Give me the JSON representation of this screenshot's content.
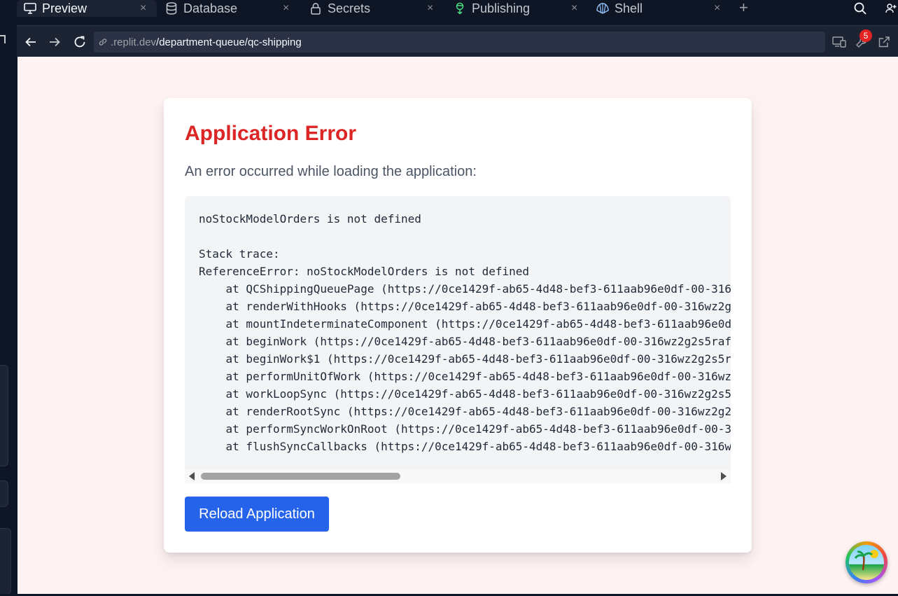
{
  "tabs": [
    {
      "label": "Preview",
      "icon": "monitor-icon",
      "active": true
    },
    {
      "label": "Database",
      "icon": "database-icon",
      "active": false
    },
    {
      "label": "Secrets",
      "icon": "lock-icon",
      "active": false
    },
    {
      "label": "Publishing",
      "icon": "publish-icon",
      "active": false
    },
    {
      "label": "Shell",
      "icon": "shell-icon",
      "active": false
    }
  ],
  "close_glyph": "×",
  "add_glyph": "+",
  "url": {
    "host": ".replit.dev",
    "path": "/department-queue/qc-shipping"
  },
  "devtools_badge": "5",
  "error": {
    "title": "Application Error",
    "subtitle": "An error occurred while loading the application:",
    "message": "noStockModelOrders is not defined",
    "stack_label": "Stack trace:",
    "exception": "ReferenceError: noStockModelOrders is not defined",
    "frames": [
      "    at QCShippingQueuePage (https://0ce1429f-ab65-4d48-bef3-611aab96e0df-00-316",
      "    at renderWithHooks (https://0ce1429f-ab65-4d48-bef3-611aab96e0df-00-316wz2g",
      "    at mountIndeterminateComponent (https://0ce1429f-ab65-4d48-bef3-611aab96e0d",
      "    at beginWork (https://0ce1429f-ab65-4d48-bef3-611aab96e0df-00-316wz2g2s5raf",
      "    at beginWork$1 (https://0ce1429f-ab65-4d48-bef3-611aab96e0df-00-316wz2g2s5r",
      "    at performUnitOfWork (https://0ce1429f-ab65-4d48-bef3-611aab96e0df-00-316wz",
      "    at workLoopSync (https://0ce1429f-ab65-4d48-bef3-611aab96e0df-00-316wz2g2s5",
      "    at renderRootSync (https://0ce1429f-ab65-4d48-bef3-611aab96e0df-00-316wz2g2",
      "    at performSyncWorkOnRoot (https://0ce1429f-ab65-4d48-bef3-611aab96e0df-00-3",
      "    at flushSyncCallbacks (https://0ce1429f-ab65-4d48-bef3-611aab96e0df-00-316w"
    ],
    "reload_label": "Reload Application"
  },
  "colors": {
    "page_bg": "#fef2f2",
    "error_red": "#dc2626",
    "button_blue": "#2563eb",
    "ide_dark": "#0e1525"
  }
}
